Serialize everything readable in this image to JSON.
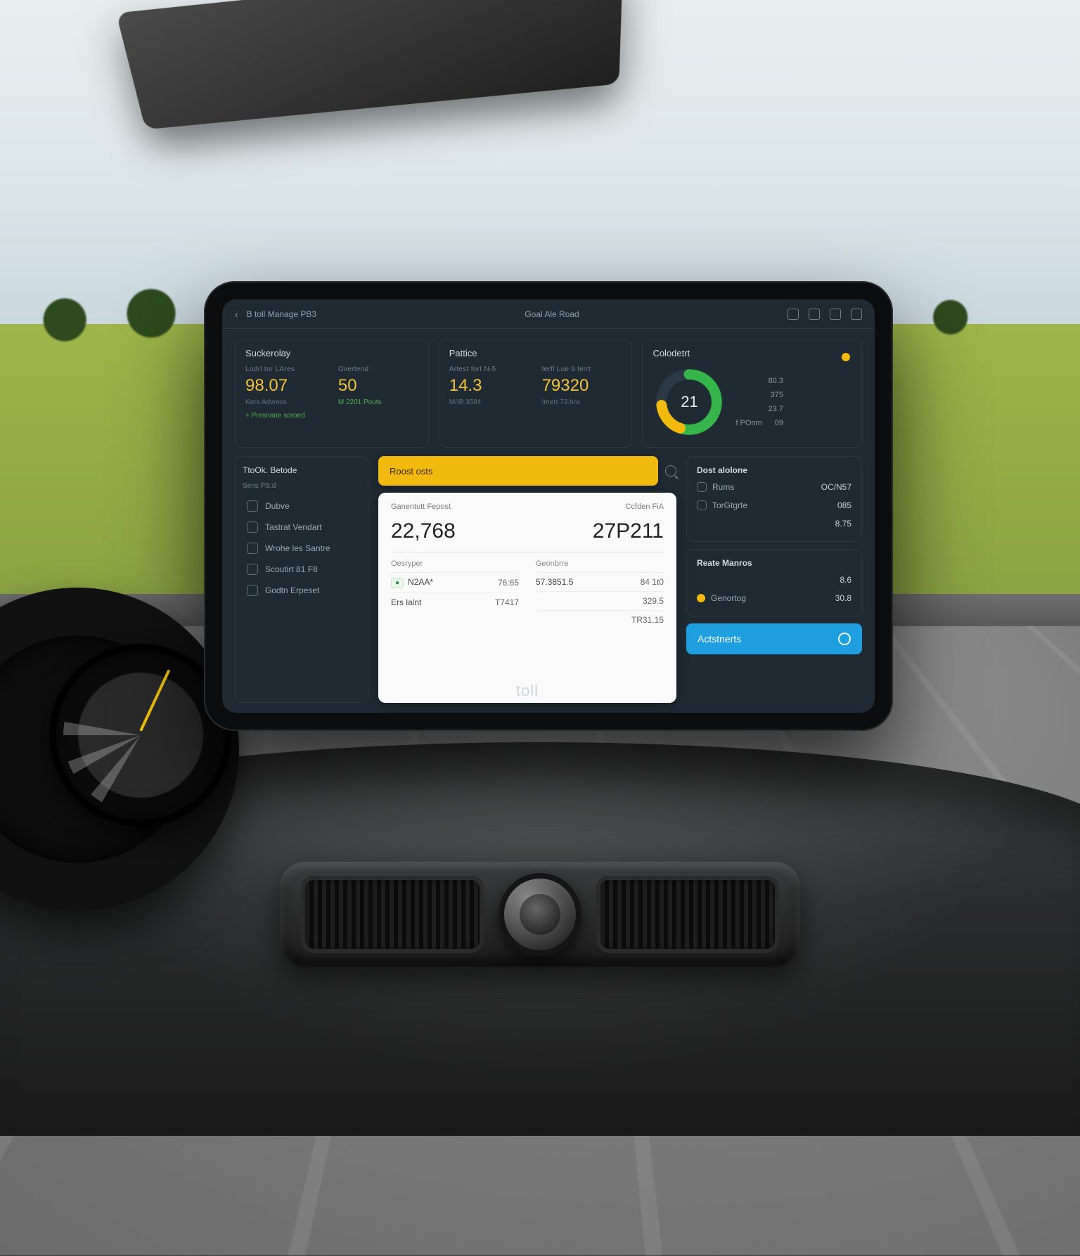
{
  "topbar": {
    "back_icon": "chevron-left",
    "breadcrumb": "B toll Manage PB3",
    "title": "Goal Ale Road",
    "icons": [
      "plug-icon",
      "card-icon",
      "chat-icon",
      "grid-icon"
    ]
  },
  "cards": {
    "summary": {
      "title": "Suckerolay",
      "left": {
        "label": "Lodrl tor LAres",
        "value": "98.07",
        "sub": "Kers Advress"
      },
      "right": {
        "label": "Overtend",
        "value": "50",
        "sub": "M 2201 Pouts"
      },
      "footnote": "+ Presnane soroed"
    },
    "pattice": {
      "title": "Pattice",
      "left": {
        "label": "Artest fort N-5",
        "value": "14.3",
        "sub": "M/IB 3584"
      },
      "right": {
        "label": "terfl Lue b lerrt",
        "value": "79320",
        "sub": "Imert 73.bra"
      }
    },
    "colodent": {
      "title": "Colodetrt",
      "center": "21",
      "legend": [
        {
          "label": "",
          "value": "80.3"
        },
        {
          "label": "",
          "value": "375"
        },
        {
          "label": "",
          "value": "23.7"
        },
        {
          "label": "f POnm",
          "value": "09"
        }
      ],
      "dot_color": "#f2b90f"
    }
  },
  "sidebar": {
    "title": "TtoOk. Betode",
    "subtitle": "Sens PS:d",
    "items": [
      {
        "icon": "phone-icon",
        "label": "Dubve"
      },
      {
        "icon": "building-icon",
        "label": "Tastrat Vendart"
      },
      {
        "icon": "battery-icon",
        "label": "Wrohe les Santre"
      },
      {
        "icon": "gear-icon",
        "label": "Scoutirt 81 F8"
      },
      {
        "icon": "wallet-icon",
        "label": "Godtn Erpeset"
      }
    ]
  },
  "pill": {
    "label": "Roost osts"
  },
  "report": {
    "header_left": "Ganentutt Fepost",
    "header_right": "Ccfden FiA",
    "big_left": "22,768",
    "big_right": "27P211",
    "section1": "Oesryper",
    "rows1": [
      {
        "k": "N2AA*",
        "v": "76:65",
        "badge": true
      },
      {
        "k": "Ers lalnt",
        "v": "T7417"
      }
    ],
    "section2": "Geonbrre",
    "rows2": [
      {
        "k": "57.3851.5",
        "v": "84 1t0"
      },
      {
        "k": "",
        "v": "329.5"
      },
      {
        "k": "",
        "v": "TR31.15"
      }
    ]
  },
  "details": {
    "title": "Dost alolone",
    "rows": [
      {
        "icon": "route-icon",
        "k": "Rums",
        "v": "OC/N57"
      },
      {
        "icon": "toll-icon",
        "k": "TorGtgrte",
        "v": "085"
      },
      {
        "icon": "",
        "k": "",
        "v": "8.75"
      }
    ]
  },
  "maros": {
    "title": "Reate Manros",
    "rows": [
      {
        "k": "",
        "v": "8.6"
      },
      {
        "dot": true,
        "k": "Genortog",
        "v": "30.8"
      }
    ]
  },
  "cta": {
    "label": "Actstnerts"
  },
  "brand": "toll",
  "colors": {
    "accent": "#f2b90f",
    "cta": "#1e9fe0",
    "good": "#35b54a",
    "ring2": "#2e8b3e"
  }
}
